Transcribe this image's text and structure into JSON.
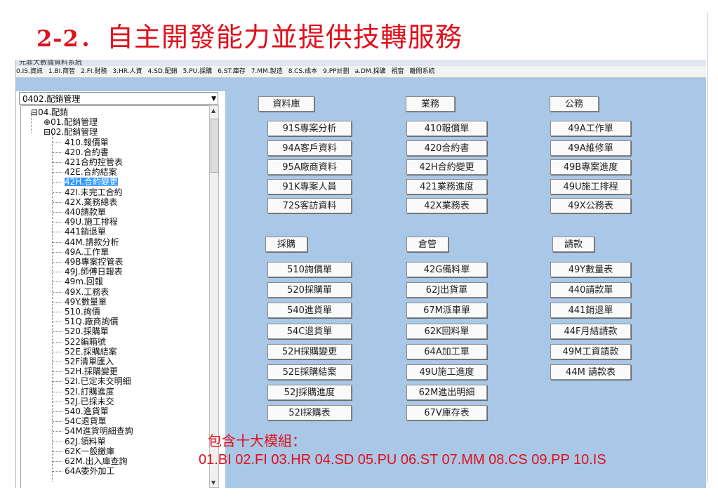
{
  "slide": {
    "title_num": "2-2",
    "title_text": "．自主開發能力並提供技轉服務"
  },
  "window": {
    "title": "元鼎大數據資料系統"
  },
  "menu": [
    "0.IS.資訊",
    "1.BI.商智",
    "2.FI.財務",
    "3.HR.人資",
    "4.SD.配銷",
    "5.PU.採購",
    "6.ST.庫存",
    "7.MM.製造",
    "8.CS.成本",
    "9.PP計劃",
    "a.DM.採礦",
    "視窗",
    "離開系統"
  ],
  "combo": {
    "value": "0402.配銷管理"
  },
  "tree": [
    {
      "label": "04.配銷",
      "sel": false
    },
    {
      "label": "01.配銷管理",
      "sel": false
    },
    {
      "label": "02.配銷管理",
      "sel": false
    },
    {
      "label": "410.報價單",
      "sel": false
    },
    {
      "label": "420.合約書",
      "sel": false
    },
    {
      "label": "421合約控管表",
      "sel": false
    },
    {
      "label": "42E.合約結案",
      "sel": false
    },
    {
      "label": "42H.合約變更",
      "sel": true
    },
    {
      "label": "42I.未完工合約",
      "sel": false
    },
    {
      "label": "42X.業務總表",
      "sel": false
    },
    {
      "label": "440請款單",
      "sel": false
    },
    {
      "label": "49U.施工排程",
      "sel": false
    },
    {
      "label": "441銷退單",
      "sel": false
    },
    {
      "label": "44M.請款分析",
      "sel": false
    },
    {
      "label": "49A.工作單",
      "sel": false
    },
    {
      "label": "49B專案控管表",
      "sel": false
    },
    {
      "label": "49J.師傅日報表",
      "sel": false
    },
    {
      "label": "49m.回報",
      "sel": false
    },
    {
      "label": "49X.工務表",
      "sel": false
    },
    {
      "label": "49Y.數量單",
      "sel": false
    },
    {
      "label": "510.詢價",
      "sel": false
    },
    {
      "label": "51Q.廠商詢價",
      "sel": false
    },
    {
      "label": "520.採購單",
      "sel": false
    },
    {
      "label": "522編箱號",
      "sel": false
    },
    {
      "label": "52E.採購結案",
      "sel": false
    },
    {
      "label": "52F清單匯入",
      "sel": false
    },
    {
      "label": "52H.採購變更",
      "sel": false
    },
    {
      "label": "52I.已定未交明細",
      "sel": false
    },
    {
      "label": "52I.訂購進度",
      "sel": false
    },
    {
      "label": "52J.已採未交",
      "sel": false
    },
    {
      "label": "540.進貨單",
      "sel": false
    },
    {
      "label": "54C退貨單",
      "sel": false
    },
    {
      "label": "54M進貨明細查詢",
      "sel": false
    },
    {
      "label": "62J.領料單",
      "sel": false
    },
    {
      "label": "62K一般繳庫",
      "sel": false
    },
    {
      "label": "62M.出入庫查詢",
      "sel": false
    },
    {
      "label": "64A委外加工",
      "sel": false
    }
  ],
  "buttons": {
    "top_headers": [
      "資料庫",
      "業務",
      "公務"
    ],
    "top_rows": [
      [
        "91S專案分析",
        "410報價單",
        "49A工作單"
      ],
      [
        "94A客戶資料",
        "420合約書",
        "49A維修單"
      ],
      [
        "95A廠商資料",
        "42H合約變更",
        "49B專案進度"
      ],
      [
        "91K專案人員",
        "421業務進度",
        "49U施工排程"
      ],
      [
        "72S客訪資料",
        "42X業務表",
        "49X公務表"
      ]
    ],
    "bottom_headers": [
      "採購",
      "倉管",
      "請款"
    ],
    "bottom_rows": [
      [
        "510詢價單",
        "42G備料單",
        "49Y數量表"
      ],
      [
        "520採購單",
        "62J出貨單",
        "440請款單"
      ],
      [
        "540進貨單",
        "67M派車單",
        "441銷退單"
      ],
      [
        "54C退貨單",
        "62K回料單",
        "44F月結請款"
      ],
      [
        "52H採購變更",
        "64A加工單",
        "49M工資請款"
      ],
      [
        "52E採購結案",
        "49U施工進度",
        "44M 請款表"
      ],
      [
        "52J採購進度",
        "62M進出明細",
        ""
      ],
      [
        "52I採購表",
        "67V庫存表",
        ""
      ]
    ]
  },
  "footer": {
    "line1": "包含十大模組：",
    "line2": "01.BI 02.FI 03.HR 04.SD 05.PU 06.ST 07.MM 08.CS 09.PP 10.IS"
  }
}
